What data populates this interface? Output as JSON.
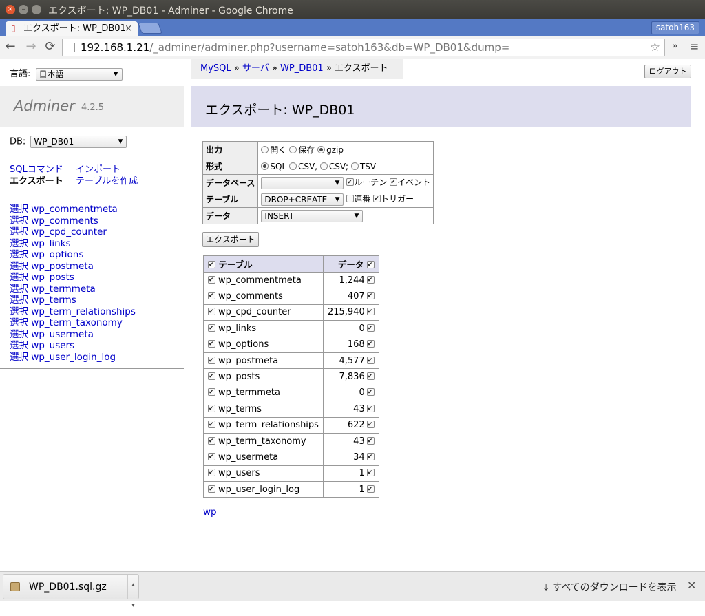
{
  "window": {
    "title": "エクスポート: WP_DB01 - Adminer - Google Chrome"
  },
  "tab": {
    "label": "エクスポート: WP_DB01",
    "close": "×",
    "user": "satoh163"
  },
  "omnibox": {
    "host": "192.168.1.21",
    "path": "/_adminer/adminer.php?username=satoh163&db=WP_DB01&dump="
  },
  "toolbar": {
    "back": "←",
    "forward": "→",
    "reload": "⟳",
    "star": "☆",
    "ext": "»",
    "menu": "≡"
  },
  "lang": {
    "label": "言語:",
    "value": "日本語"
  },
  "adminer": {
    "name": "Adminer",
    "version": "4.2.5"
  },
  "db": {
    "label": "DB:",
    "value": "WP_DB01"
  },
  "side_links": {
    "sql": "SQLコマンド",
    "import": "インポート",
    "export": "エクスポート",
    "create": "テーブルを作成"
  },
  "tables_nav": {
    "select_label": "選択",
    "items": [
      "wp_commentmeta",
      "wp_comments",
      "wp_cpd_counter",
      "wp_links",
      "wp_options",
      "wp_postmeta",
      "wp_posts",
      "wp_termmeta",
      "wp_terms",
      "wp_term_relationships",
      "wp_term_taxonomy",
      "wp_usermeta",
      "wp_users",
      "wp_user_login_log"
    ]
  },
  "breadcrumb": {
    "mysql": "MySQL",
    "sep": "»",
    "server": "サーバ",
    "db": "WP_DB01",
    "current": "エクスポート"
  },
  "logout": "ログアウト",
  "heading": "エクスポート: WP_DB01",
  "options": {
    "output": {
      "label": "出力",
      "open": "開く",
      "save": "保存",
      "gzip": "gzip",
      "selected": "gzip"
    },
    "format": {
      "label": "形式",
      "sql": "SQL",
      "csv_comma": "CSV,",
      "csv_semi": "CSV;",
      "tsv": "TSV",
      "selected": "SQL"
    },
    "database": {
      "label": "データベース",
      "value": "",
      "routines": "ルーチン",
      "events": "イベント"
    },
    "table": {
      "label": "テーブル",
      "value": "DROP+CREATE",
      "auto_increment": "連番",
      "triggers": "トリガー"
    },
    "data": {
      "label": "データ",
      "value": "INSERT"
    }
  },
  "export_button": "エクスポート",
  "table_list": {
    "header_table": "テーブル",
    "header_data": "データ",
    "rows": [
      {
        "name": "wp_commentmeta",
        "count": "1,244"
      },
      {
        "name": "wp_comments",
        "count": "407"
      },
      {
        "name": "wp_cpd_counter",
        "count": "215,940"
      },
      {
        "name": "wp_links",
        "count": "0"
      },
      {
        "name": "wp_options",
        "count": "168"
      },
      {
        "name": "wp_postmeta",
        "count": "4,577"
      },
      {
        "name": "wp_posts",
        "count": "7,836"
      },
      {
        "name": "wp_termmeta",
        "count": "0"
      },
      {
        "name": "wp_terms",
        "count": "43"
      },
      {
        "name": "wp_term_relationships",
        "count": "622"
      },
      {
        "name": "wp_term_taxonomy",
        "count": "43"
      },
      {
        "name": "wp_usermeta",
        "count": "34"
      },
      {
        "name": "wp_users",
        "count": "1"
      },
      {
        "name": "wp_user_login_log",
        "count": "1"
      }
    ]
  },
  "prefix": "wp",
  "download": {
    "file": "WP_DB01.sql.gz",
    "show_all": "すべてのダウンロードを表示",
    "close": "✕"
  }
}
